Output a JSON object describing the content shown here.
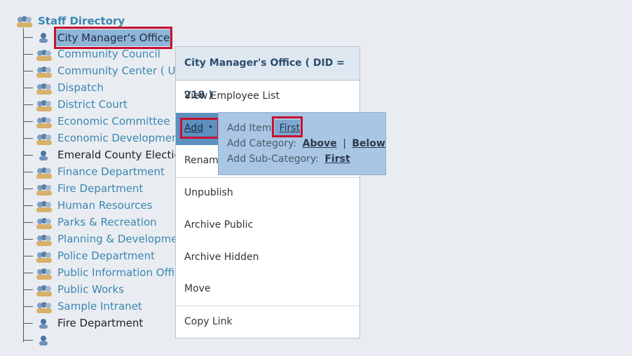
{
  "tree": {
    "root_label": "Staff Directory",
    "selected_label": "City Manager's Office",
    "items": [
      {
        "label": "Community Council",
        "dark": false
      },
      {
        "label": "Community Center ( Un",
        "dark": false
      },
      {
        "label": "Dispatch",
        "dark": false
      },
      {
        "label": "District Court",
        "dark": false
      },
      {
        "label": "Economic Committee",
        "dark": false
      },
      {
        "label": "Economic Development",
        "dark": false
      },
      {
        "label": "Emerald County Electio",
        "dark": true
      },
      {
        "label": "Finance Department",
        "dark": false
      },
      {
        "label": "Fire Department",
        "dark": false
      },
      {
        "label": "Human Resources",
        "dark": false
      },
      {
        "label": "Parks & Recreation",
        "dark": false
      },
      {
        "label": "Planning & Developme",
        "dark": false
      },
      {
        "label": "Police Department",
        "dark": false
      },
      {
        "label": "Public Information Offic",
        "dark": false
      },
      {
        "label": "Public Works",
        "dark": false
      },
      {
        "label": "Sample Intranet",
        "dark": false
      },
      {
        "label": "Fire Department",
        "dark": true
      },
      {
        "label": "",
        "dark": false
      }
    ]
  },
  "menu": {
    "header": "City Manager's Office ( DID = 218 )",
    "view_employee_list": "View Employee List",
    "add": "Add",
    "add_arrow": "▸",
    "rename": "Renam",
    "unpublish": "Unpublish",
    "archive_public": "Archive Public",
    "archive_hidden": "Archive Hidden",
    "move": "Move",
    "copy_link": "Copy Link"
  },
  "submenu": {
    "add_item_label": "Add Item:",
    "add_item_first": "First",
    "add_category_label": "Add Category:",
    "above": "Above",
    "sep": "|",
    "below": "Below",
    "add_subcategory_label": "Add Sub-Category:",
    "sub_first": "First"
  },
  "colors": {
    "link": "#3b86b0",
    "selection": "#8fb5d8",
    "highlight_box": "#c8102e",
    "submenu_bg": "#a9c6e4",
    "add_bg": "#5c90bf"
  }
}
